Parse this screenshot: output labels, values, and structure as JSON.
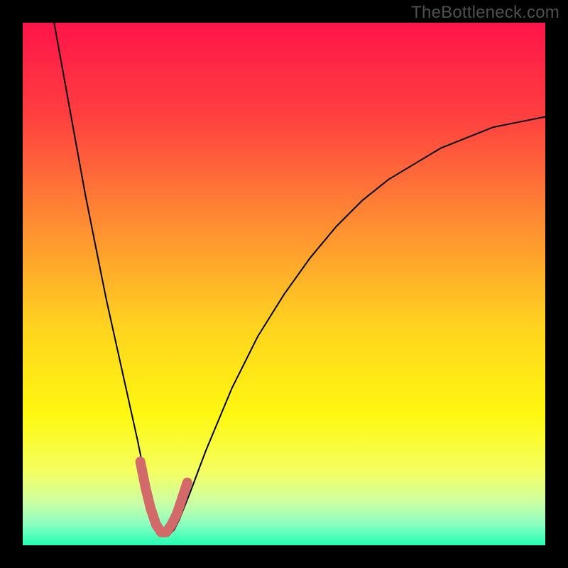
{
  "attribution": "TheBottleneck.com",
  "colors": {
    "page_bg": "#000000",
    "attribution_text": "#4f4f4f",
    "curve_stroke": "#000000",
    "highlight_stroke": "#d36a6a",
    "gradient_stops": [
      {
        "offset": 0,
        "color": "#ff144a"
      },
      {
        "offset": 18,
        "color": "#ff4040"
      },
      {
        "offset": 38,
        "color": "#ff8b33"
      },
      {
        "offset": 58,
        "color": "#ffd31f"
      },
      {
        "offset": 75,
        "color": "#fff810"
      },
      {
        "offset": 86,
        "color": "#f4ff62"
      },
      {
        "offset": 92,
        "color": "#caffa6"
      },
      {
        "offset": 96,
        "color": "#8affc0"
      },
      {
        "offset": 100,
        "color": "#22ffb4"
      }
    ]
  },
  "chart_data": {
    "type": "line",
    "title": "",
    "xlabel": "",
    "ylabel": "",
    "xlim": [
      0,
      100
    ],
    "ylim": [
      0,
      100
    ],
    "annotations": [
      "TheBottleneck.com"
    ],
    "series": [
      {
        "name": "bottleneck-curve",
        "x": [
          6,
          8,
          10,
          12,
          14,
          16,
          18,
          20,
          22,
          23,
          24,
          25,
          26,
          27,
          28,
          29,
          30,
          32,
          35,
          40,
          45,
          50,
          55,
          60,
          65,
          70,
          75,
          80,
          85,
          90,
          95,
          100
        ],
        "y": [
          100,
          89,
          78,
          67,
          57,
          47,
          38,
          29,
          20,
          15,
          10,
          6,
          3,
          2,
          2,
          3,
          5,
          10,
          18,
          30,
          40,
          48,
          55,
          61,
          66,
          70,
          73,
          76,
          78,
          80,
          81,
          82
        ]
      },
      {
        "name": "optimal-region-highlight",
        "x": [
          22.5,
          23.5,
          24.5,
          25.5,
          26.5,
          27.5,
          28.5,
          29.5,
          30.5,
          31.5
        ],
        "y": [
          16,
          11,
          7,
          4,
          2.5,
          2.5,
          4,
          6,
          9,
          12
        ]
      }
    ]
  }
}
